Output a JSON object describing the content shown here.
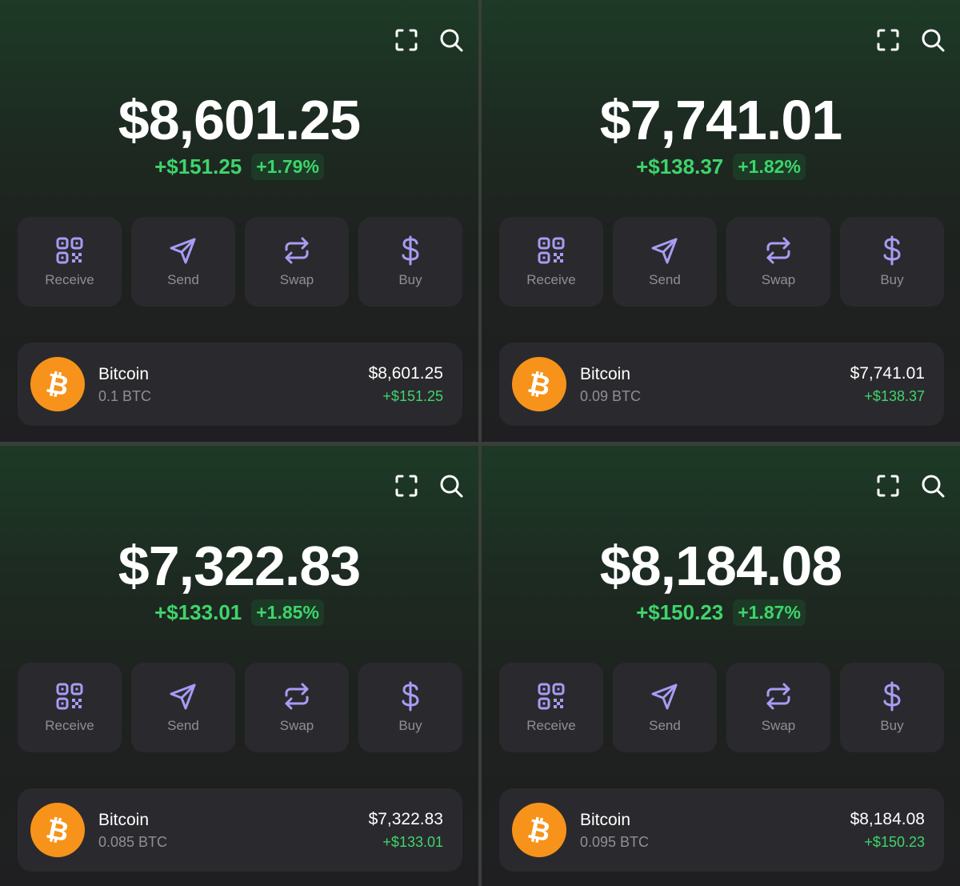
{
  "colors": {
    "accent_green": "#3fd46b",
    "icon_purple": "#a89cf5",
    "bitcoin_orange": "#f7931a",
    "card_bg": "#2a2a2e"
  },
  "panels": [
    {
      "balance": "$8,601.25",
      "change_amount": "+$151.25",
      "change_percent": "+1.79%",
      "actions": [
        {
          "label": "Receive",
          "icon": "qr-code-icon"
        },
        {
          "label": "Send",
          "icon": "send-icon"
        },
        {
          "label": "Swap",
          "icon": "swap-icon"
        },
        {
          "label": "Buy",
          "icon": "dollar-icon"
        }
      ],
      "asset": {
        "name": "Bitcoin",
        "quantity": "0.1 BTC",
        "value": "$8,601.25",
        "change": "+$151.25"
      }
    },
    {
      "balance": "$7,741.01",
      "change_amount": "+$138.37",
      "change_percent": "+1.82%",
      "actions": [
        {
          "label": "Receive",
          "icon": "qr-code-icon"
        },
        {
          "label": "Send",
          "icon": "send-icon"
        },
        {
          "label": "Swap",
          "icon": "swap-icon"
        },
        {
          "label": "Buy",
          "icon": "dollar-icon"
        }
      ],
      "asset": {
        "name": "Bitcoin",
        "quantity": "0.09 BTC",
        "value": "$7,741.01",
        "change": "+$138.37"
      }
    },
    {
      "balance": "$7,322.83",
      "change_amount": "+$133.01",
      "change_percent": "+1.85%",
      "actions": [
        {
          "label": "Receive",
          "icon": "qr-code-icon"
        },
        {
          "label": "Send",
          "icon": "send-icon"
        },
        {
          "label": "Swap",
          "icon": "swap-icon"
        },
        {
          "label": "Buy",
          "icon": "dollar-icon"
        }
      ],
      "asset": {
        "name": "Bitcoin",
        "quantity": "0.085 BTC",
        "value": "$7,322.83",
        "change": "+$133.01"
      }
    },
    {
      "balance": "$8,184.08",
      "change_amount": "+$150.23",
      "change_percent": "+1.87%",
      "actions": [
        {
          "label": "Receive",
          "icon": "qr-code-icon"
        },
        {
          "label": "Send",
          "icon": "send-icon"
        },
        {
          "label": "Swap",
          "icon": "swap-icon"
        },
        {
          "label": "Buy",
          "icon": "dollar-icon"
        }
      ],
      "asset": {
        "name": "Bitcoin",
        "quantity": "0.095 BTC",
        "value": "$8,184.08",
        "change": "+$150.23"
      }
    }
  ]
}
